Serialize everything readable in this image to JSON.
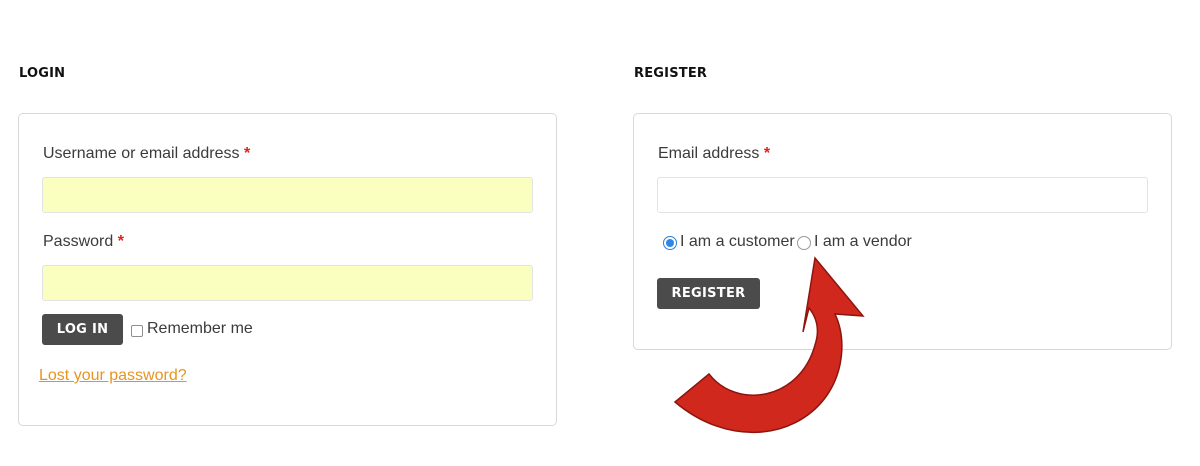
{
  "login": {
    "heading": "LOGIN",
    "username_label": "Username or email address",
    "username_value": "",
    "password_label": "Password",
    "password_value": "",
    "required_mark": "*",
    "login_button": "LOG IN",
    "remember_label": "Remember me",
    "remember_checked": false,
    "lost_password_link": "Lost your password?"
  },
  "register": {
    "heading": "REGISTER",
    "email_label": "Email address",
    "email_value": "",
    "required_mark": "*",
    "role_options": [
      {
        "label": "I am a customer",
        "selected": true
      },
      {
        "label": "I am a vendor",
        "selected": false
      }
    ],
    "register_button": "REGISTER"
  },
  "annotation": {
    "arrow_icon": "curved-arrow-icon",
    "arrow_color": "#d0281d"
  },
  "colors": {
    "autofill_bg": "#fafebf",
    "button_bg": "#4b4b4b",
    "link": "#e89420",
    "required": "#e0201a",
    "radio_selected": "#2f86e6"
  }
}
